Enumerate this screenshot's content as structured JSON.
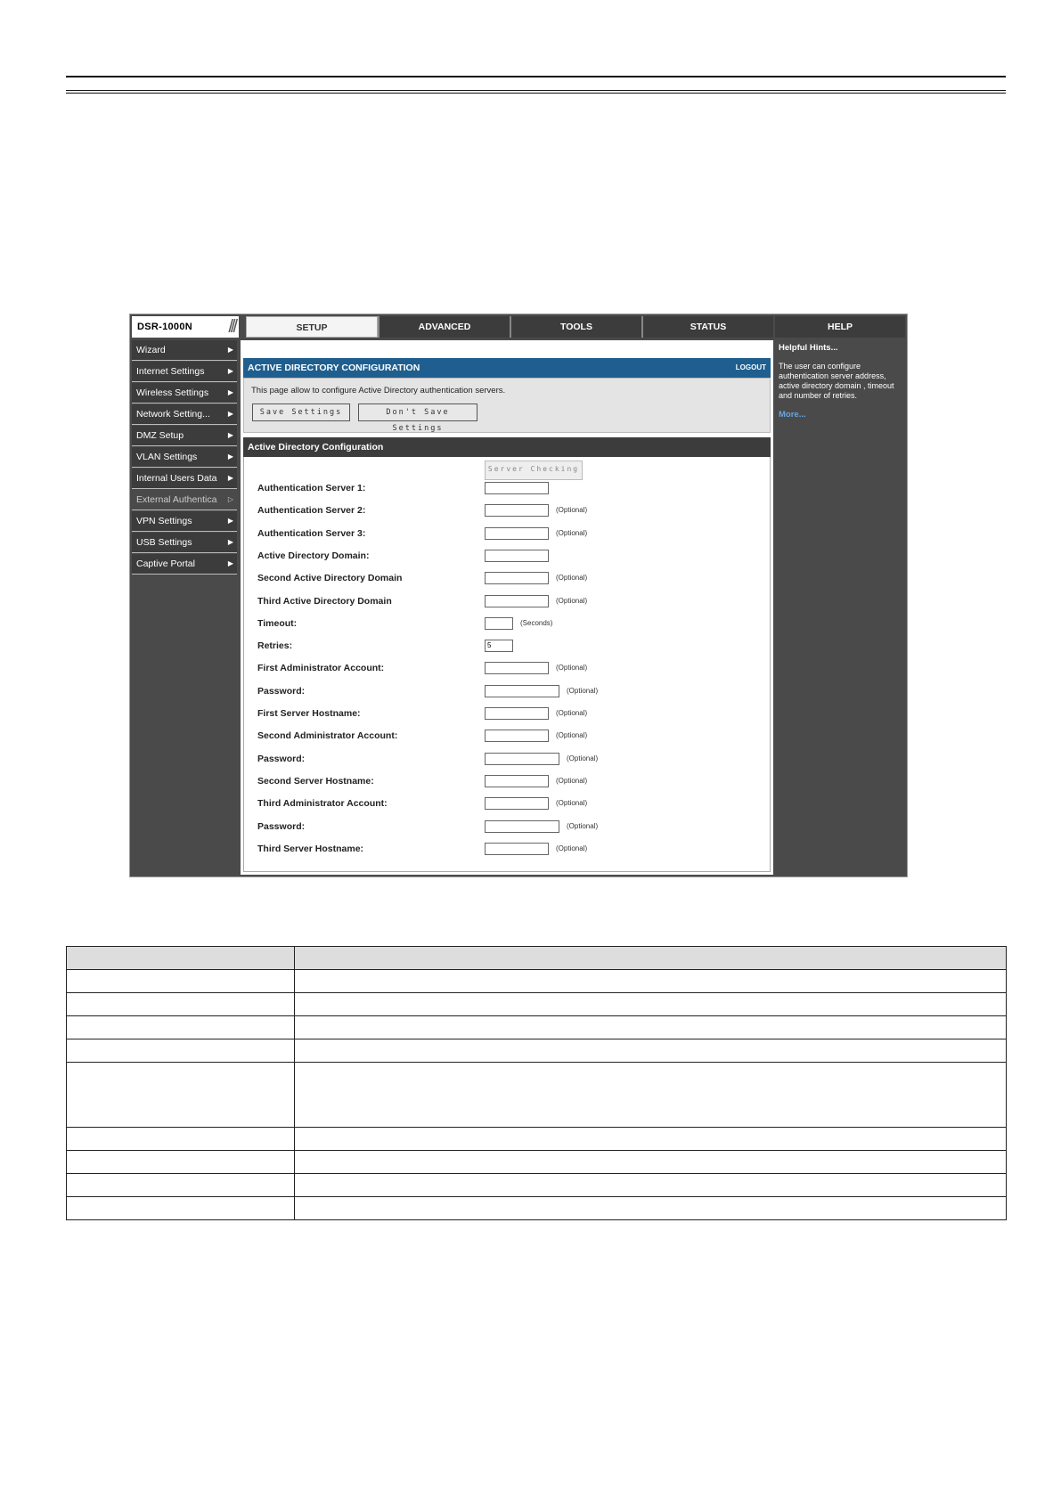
{
  "header": {
    "logo": "DSR-1000N"
  },
  "tabs": [
    {
      "label": "SETUP",
      "active": true
    },
    {
      "label": "ADVANCED",
      "active": false
    },
    {
      "label": "TOOLS",
      "active": false
    },
    {
      "label": "STATUS",
      "active": false
    }
  ],
  "help_tab": "HELP",
  "sidebar": {
    "items": [
      {
        "label": "Wizard",
        "active": false
      },
      {
        "label": "Internet Settings",
        "active": false
      },
      {
        "label": "Wireless Settings",
        "active": false
      },
      {
        "label": "Network Setting...",
        "active": false
      },
      {
        "label": "DMZ Setup",
        "active": false
      },
      {
        "label": "VLAN Settings",
        "active": false
      },
      {
        "label": "Internal Users Data",
        "active": false
      },
      {
        "label": "External Authentica",
        "active": true
      },
      {
        "label": "VPN Settings",
        "active": false
      },
      {
        "label": "USB Settings",
        "active": false
      },
      {
        "label": "Captive Portal",
        "active": false
      }
    ]
  },
  "panel": {
    "title": "ACTIVE DIRECTORY CONFIGURATION",
    "logout": "LOGOUT",
    "description": "This page allow to configure Active Directory authentication servers.",
    "save_label": "Save Settings",
    "dont_save_label": "Don't Save Settings"
  },
  "section": {
    "title": "Active Directory Configuration",
    "server_checking_label": "Server Checking"
  },
  "fields": [
    {
      "label": "Authentication Server 1:",
      "value": "",
      "note": ""
    },
    {
      "label": "Authentication Server 2:",
      "value": "",
      "note": "(Optional)"
    },
    {
      "label": "Authentication Server 3:",
      "value": "",
      "note": "(Optional)"
    },
    {
      "label": "Active Directory Domain:",
      "value": "",
      "note": ""
    },
    {
      "label": "Second Active Directory Domain",
      "value": "",
      "note": "(Optional)"
    },
    {
      "label": "Third Active Directory Domain",
      "value": "",
      "note": "(Optional)"
    },
    {
      "label": "Timeout:",
      "value": "",
      "note": "(Seconds)"
    },
    {
      "label": "Retries:",
      "value": "5",
      "note": ""
    },
    {
      "label": "First Administrator Account:",
      "value": "",
      "note": "(Optional)"
    },
    {
      "label": "Password:",
      "value": "",
      "note": "(Optional)"
    },
    {
      "label": "First Server Hostname:",
      "value": "",
      "note": "(Optional)"
    },
    {
      "label": "Second Administrator Account:",
      "value": "",
      "note": "(Optional)"
    },
    {
      "label": "Password:",
      "value": "",
      "note": "(Optional)"
    },
    {
      "label": "Second Server Hostname:",
      "value": "",
      "note": "(Optional)"
    },
    {
      "label": "Third Administrator Account:",
      "value": "",
      "note": "(Optional)"
    },
    {
      "label": "Password:",
      "value": "",
      "note": "(Optional)"
    },
    {
      "label": "Third Server Hostname:",
      "value": "",
      "note": "(Optional)"
    }
  ],
  "help": {
    "title": "Helpful Hints...",
    "text": "The user can configure authentication server address, active directory domain , timeout and number of retries.",
    "more": "More..."
  }
}
